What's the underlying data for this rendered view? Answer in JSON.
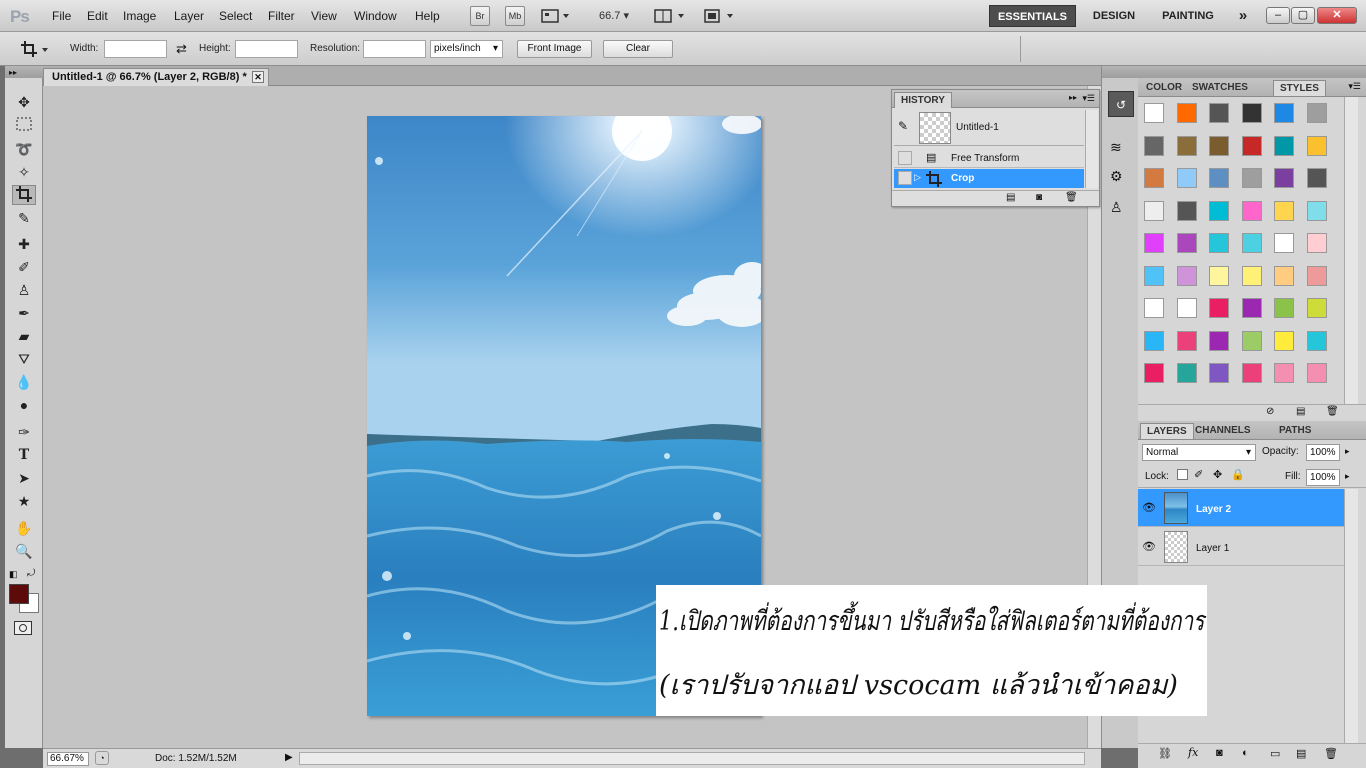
{
  "app": {
    "logo_text": "Ps"
  },
  "menu": [
    "File",
    "Edit",
    "Image",
    "Layer",
    "Select",
    "Filter",
    "View",
    "Window",
    "Help"
  ],
  "menubar_buttons": {
    "bridge": "Br",
    "mini_bridge": "Mb",
    "zoom": "66.7"
  },
  "workspaces": [
    "ESSENTIALS",
    "DESIGN",
    "PAINTING",
    "»"
  ],
  "window_controls": [
    "–",
    "▢",
    "✕"
  ],
  "options": {
    "width_label": "Width:",
    "height_label": "Height:",
    "resolution_label": "Resolution:",
    "units_value": "pixels/inch",
    "front_image_label": "Front Image",
    "clear_label": "Clear"
  },
  "document": {
    "tab_title": "Untitled-1 @ 66.7% (Layer 2, RGB/8) *"
  },
  "status": {
    "zoom": "66.67%",
    "doc_size": "Doc: 1.52M/1.52M"
  },
  "history": {
    "title": "HISTORY",
    "snapshot": "Untitled-1",
    "states": [
      {
        "label": "Free Transform",
        "icon": "free-transform-icon",
        "active": false
      },
      {
        "label": "Crop",
        "icon": "crop-icon",
        "active": true
      }
    ]
  },
  "panels_top": {
    "tabs": [
      "COLOR",
      "SWATCHES",
      "STYLES"
    ],
    "active": "STYLES"
  },
  "styles": [
    "#ffffff",
    "#ff6a00",
    "#555555",
    "#333333",
    "#1e88e5",
    "#9e9e9e",
    "#666666",
    "#8a6d3b",
    "#7a5c2e",
    "#c62828",
    "#0097a7",
    "#fbc02d",
    "#d27a40",
    "#90caf9",
    "#5d8fc2",
    "#9e9e9e",
    "#7b3fa0",
    "#555555",
    "#eeeeee",
    "#555555",
    "#00bcd4",
    "#ff66cc",
    "#ffd54f",
    "#80deea",
    "#e040fb",
    "#ab47bc",
    "#26c6da",
    "#4dd0e1",
    "#ffffff",
    "#ffcdd2",
    "#4fc3f7",
    "#ce93d8",
    "#fff59d",
    "#fff176",
    "#ffcc80",
    "#ef9a9a",
    "#ffffff",
    "#ffffff",
    "#e91e63",
    "#9c27b0",
    "#8bc34a",
    "#cddc39",
    "#29b6f6",
    "#ec407a",
    "#9c27b0",
    "#9ccc65",
    "#ffeb3b",
    "#26c6da",
    "#e91e63",
    "#26a69a",
    "#7e57c2",
    "#ec407a",
    "#f48fb1",
    "#f48fb1"
  ],
  "layers_panel": {
    "tabs": [
      "LAYERS",
      "CHANNELS",
      "PATHS"
    ],
    "active": "LAYERS",
    "blend_mode": "Normal",
    "opacity_label": "Opacity:",
    "opacity_value": "100%",
    "lock_label": "Lock:",
    "fill_label": "Fill:",
    "fill_value": "100%",
    "layers": [
      {
        "name": "Layer 2",
        "selected": true
      },
      {
        "name": "Layer 1",
        "selected": false
      }
    ]
  },
  "annotation": {
    "line1": "1.เปิดภาพที่ต้องการขึ้นมา ปรับสีหรือใส่ฟิลเตอร์ตามที่ต้องการ",
    "line2": "(เราปรับจากแอป vscocam แล้วนำเข้าคอม)"
  },
  "colors": {
    "foreground": "#5c0a0a",
    "background": "#ffffff",
    "selection": "#3399ff"
  }
}
